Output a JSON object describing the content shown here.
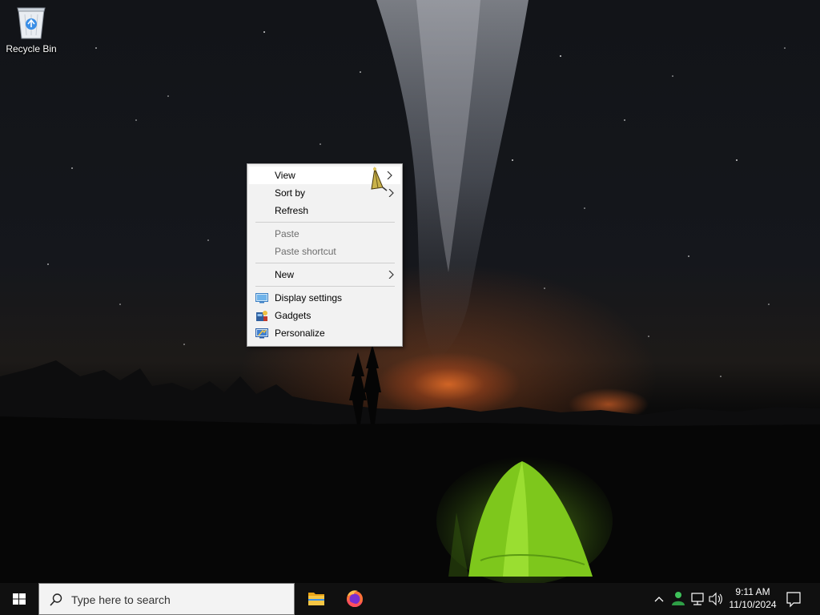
{
  "desktop": {
    "icons": [
      {
        "label": "Recycle Bin",
        "icon": "recycle-bin-icon"
      }
    ]
  },
  "context_menu": {
    "items": [
      {
        "label": "View",
        "submenu": true,
        "highlighted": true
      },
      {
        "label": "Sort by",
        "submenu": true
      },
      {
        "label": "Refresh"
      },
      {
        "label": "Paste",
        "disabled": true
      },
      {
        "label": "Paste shortcut",
        "disabled": true
      },
      {
        "label": "New",
        "submenu": true
      },
      {
        "label": "Display settings",
        "icon": "display-settings-icon"
      },
      {
        "label": "Gadgets",
        "icon": "gadgets-icon"
      },
      {
        "label": "Personalize",
        "icon": "personalize-icon"
      }
    ]
  },
  "taskbar": {
    "search_placeholder": "Type here to search",
    "pinned": [
      {
        "name": "file-explorer-icon"
      },
      {
        "name": "firefox-icon"
      }
    ],
    "clock": {
      "time": "9:11 AM",
      "date": "11/10/2024"
    }
  },
  "colors": {
    "taskbar": "#101010",
    "menu_bg": "#f2f2f2",
    "menu_disabled": "#6d6d6d",
    "search_bg": "#f3f3f3"
  }
}
